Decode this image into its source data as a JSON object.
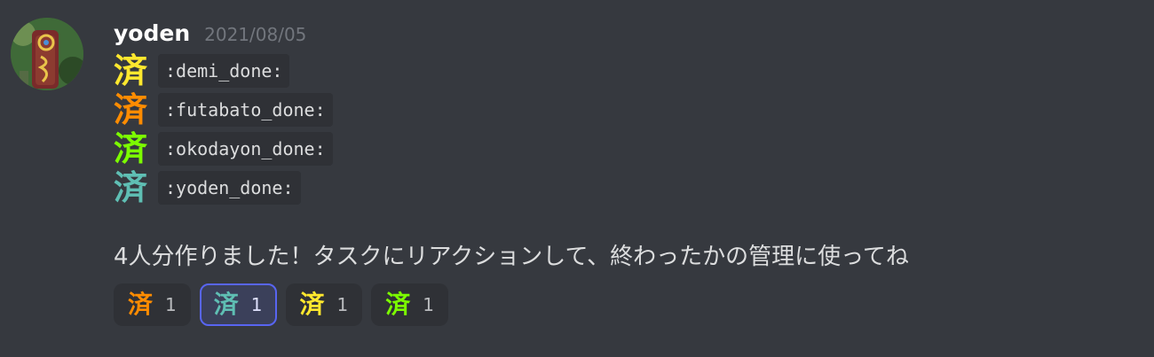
{
  "message": {
    "username": "yoden",
    "timestamp": "2021/08/05",
    "emoji_lines": [
      {
        "glyph": "済",
        "code": ":demi_done:",
        "color": "#ffe82e"
      },
      {
        "glyph": "済",
        "code": ":futabato_done:",
        "color": "#ff8c00"
      },
      {
        "glyph": "済",
        "code": ":okodayon_done:",
        "color": "#7cfc00"
      },
      {
        "glyph": "済",
        "code": ":yoden_done:",
        "color": "#5fbfb4"
      }
    ],
    "text": "4人分作りました！タスクにリアクションして、終わったかの管理に使ってね"
  },
  "reactions": [
    {
      "glyph": "済",
      "count": "1",
      "color": "#ff8c00",
      "active": false
    },
    {
      "glyph": "済",
      "count": "1",
      "color": "#5fbfb4",
      "active": true
    },
    {
      "glyph": "済",
      "count": "1",
      "color": "#ffe82e",
      "active": false
    },
    {
      "glyph": "済",
      "count": "1",
      "color": "#7cfc00",
      "active": false
    }
  ],
  "colors": {
    "background": "#36393f",
    "code_background": "#2f3136",
    "active_reaction_border": "#5865f2"
  },
  "icons": {
    "avatar": "user-avatar"
  }
}
